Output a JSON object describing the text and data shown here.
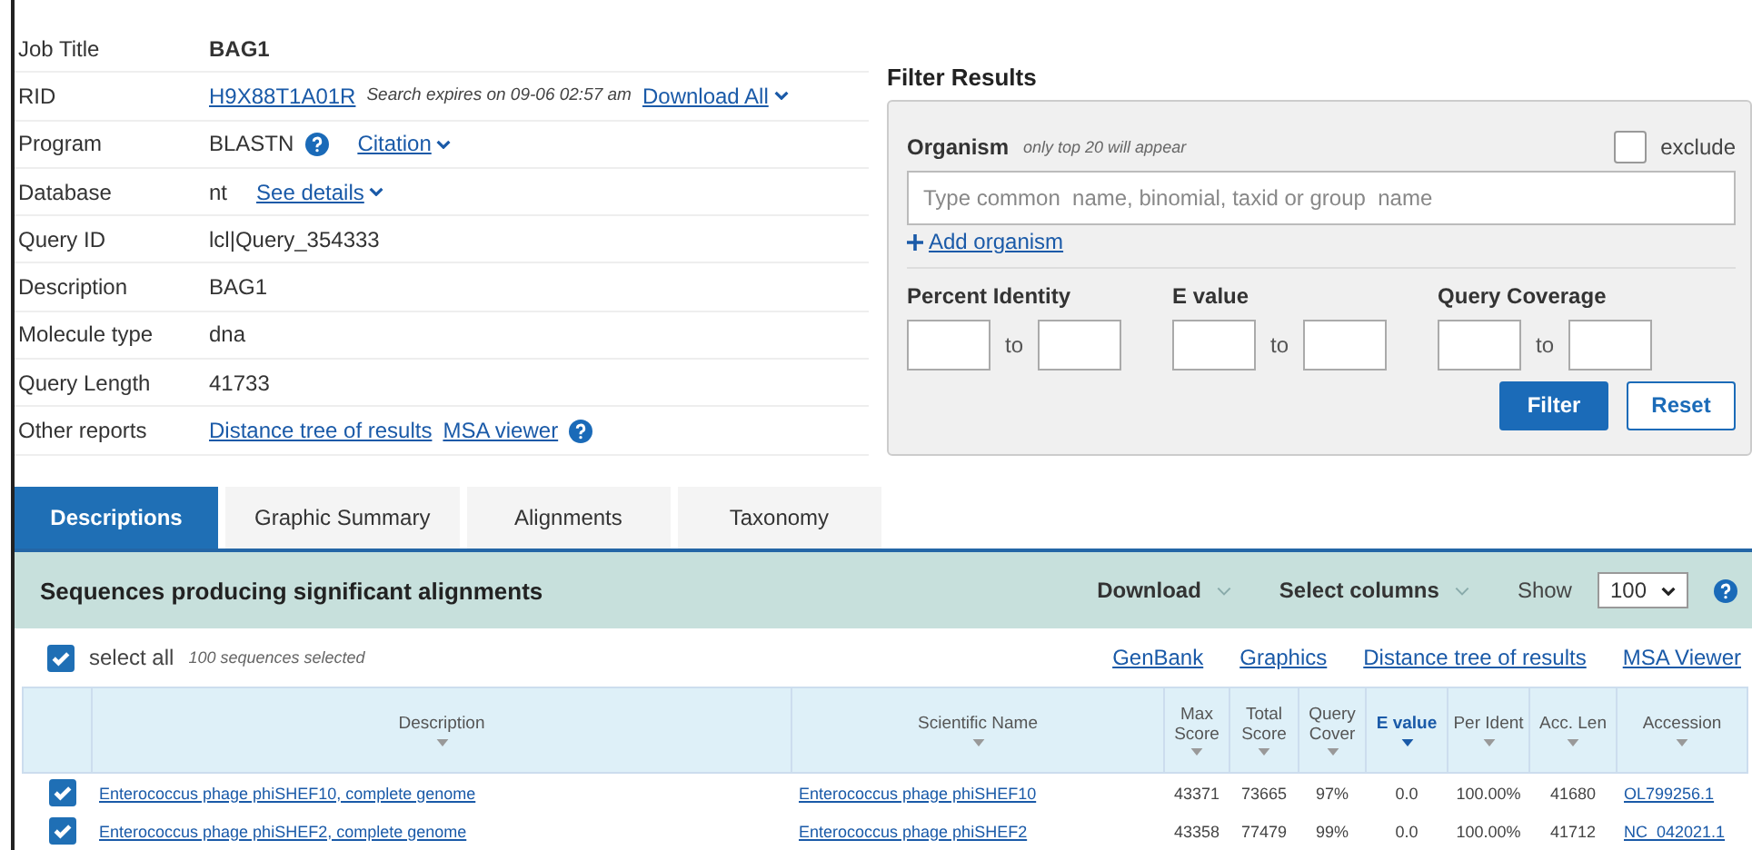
{
  "job_info": [
    {
      "label": "Job Title",
      "kind": "bold",
      "value": "BAG1"
    },
    {
      "label": "RID",
      "kind": "rid",
      "link": "H9X88T1A01R",
      "note": "Search expires on 09-06 02:57 am",
      "menu": "Download All"
    },
    {
      "label": "Program",
      "kind": "program",
      "value": "BLASTN",
      "menu": "Citation"
    },
    {
      "label": "Database",
      "kind": "database",
      "value": "nt",
      "menu": "See details"
    },
    {
      "label": "Query ID",
      "kind": "plain",
      "value": "lcl|Query_354333"
    },
    {
      "label": "Description",
      "kind": "plain",
      "value": "BAG1"
    },
    {
      "label": "Molecule type",
      "kind": "plain",
      "value": "dna"
    },
    {
      "label": "Query Length",
      "kind": "plain",
      "value": "41733"
    },
    {
      "label": "Other reports",
      "kind": "links",
      "links": [
        "Distance tree of results",
        "MSA viewer"
      ]
    }
  ],
  "filter": {
    "title": "Filter Results",
    "organism_label": "Organism",
    "organism_hint": "only top 20 will appear",
    "exclude_label": "exclude",
    "exclude_checked": false,
    "placeholder": "Type common  name, binomial, taxid or group  name",
    "add_link": "Add organism",
    "ranges": [
      {
        "label": "Percent Identity",
        "to": "to"
      },
      {
        "label": "E value",
        "to": "to"
      },
      {
        "label": "Query Coverage",
        "to": "to"
      }
    ],
    "buttons": [
      "Filter",
      "Reset"
    ]
  },
  "tabs": [
    {
      "label": "Descriptions",
      "selected": true
    },
    {
      "label": "Graphic Summary",
      "selected": false
    },
    {
      "label": "Alignments",
      "selected": false
    },
    {
      "label": "Taxonomy",
      "selected": false
    }
  ],
  "results": {
    "title": "Sequences producing significant alignments",
    "download": "Download",
    "select_columns": "Select columns",
    "show_label": "Show",
    "show_value": "100",
    "select_all": {
      "label": "select all",
      "checked": true,
      "note": "100 sequences selected"
    },
    "links": [
      "GenBank",
      "Graphics",
      "Distance tree of results",
      "MSA Viewer"
    ],
    "columns": [
      {
        "label": "Description",
        "bold": false
      },
      {
        "label": "Scientific Name",
        "bold": false
      },
      {
        "label": "Max Score",
        "bold": false
      },
      {
        "label": "Total Score",
        "bold": false
      },
      {
        "label": "Query Cover",
        "bold": false
      },
      {
        "label": "E value",
        "bold": true
      },
      {
        "label": "Per Ident",
        "bold": false
      },
      {
        "label": "Acc. Len",
        "bold": false
      },
      {
        "label": "Accession",
        "bold": false
      }
    ],
    "rows": [
      {
        "checked": true,
        "cells": [
          "Enterococcus phage phiSHEF10, complete genome",
          "Enterococcus phage phiSHEF10",
          "43371",
          "73665",
          "97%",
          "0.0",
          "100.00%",
          "41680",
          "OL799256.1"
        ]
      },
      {
        "checked": true,
        "cells": [
          "Enterococcus phage phiSHEF2, complete genome",
          "Enterococcus phage phiSHEF2",
          "43358",
          "77479",
          "99%",
          "0.0",
          "100.00%",
          "41712",
          "NC_042021.1"
        ]
      }
    ]
  }
}
